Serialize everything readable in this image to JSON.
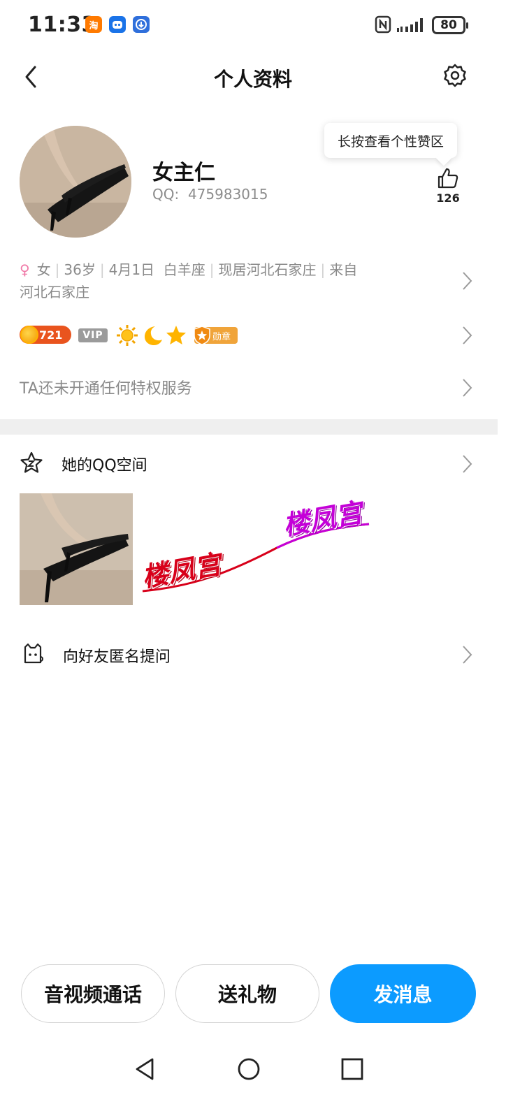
{
  "status_bar": {
    "time": "11:33",
    "apps": [
      {
        "icon": "taobao-app-icon",
        "glyph": "淘",
        "color": "#ff7a00"
      },
      {
        "icon": "robot-app-icon",
        "glyph": "◉",
        "color": "#1a73e8"
      },
      {
        "icon": "download-app-icon",
        "glyph": "⬇",
        "color": "#2f6fdb"
      }
    ],
    "battery": "80"
  },
  "header": {
    "title": "个人资料"
  },
  "profile": {
    "nickname": "女主仁",
    "qq_label": "QQ:",
    "qq_number": "475983015",
    "tooltip": "长按查看个性赞区",
    "like_count": "126"
  },
  "info": {
    "gender_icon": "♀",
    "gender": "女",
    "age": "36岁",
    "birthday": "4月1日",
    "zodiac": "白羊座",
    "residence": "现居河北石家庄",
    "hometown_prefix": "来自",
    "hometown": "河北石家庄"
  },
  "badges": {
    "level": "721",
    "vip": "VIP",
    "medal": "勋章"
  },
  "privilege": {
    "text": "TA还未开通任何特权服务"
  },
  "qzone": {
    "label": "她的QQ空间",
    "watermark_1": "楼凤宫",
    "watermark_2": "楼凤宫"
  },
  "ask": {
    "label": "向好友匿名提问"
  },
  "actions": {
    "call": "音视频通话",
    "gift": "送礼物",
    "message": "发消息"
  },
  "colors": {
    "accent": "#0c9bff",
    "female": "#f07aa8",
    "secondary_text": "#8a8a8a"
  }
}
